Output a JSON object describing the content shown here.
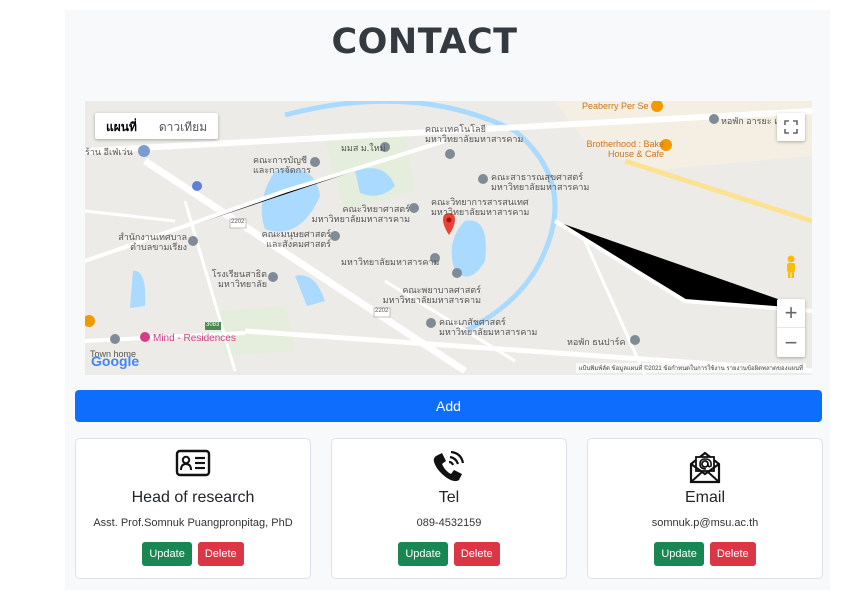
{
  "page": {
    "title": "CONTACT"
  },
  "map": {
    "type_buttons": [
      "แผนที่",
      "ดาวเทียม"
    ],
    "fullscreen_icon": "fullscreen-icon",
    "zoom_in": "+",
    "zoom_out": "−",
    "logo": "Google",
    "footer": "แป้นพิมพ์ลัด   ข้อมูลแผนที่ ©2021   ข้อกำหนดในการใช้งาน   รายงานข้อผิดพลาดของแผนที่",
    "labels": {
      "peaberry": "Peaberry Per Se",
      "brotherhood": "Brotherhood : Bake House & Cafe",
      "dorm_top": "หอพัก อารยะ แ",
      "cafe_left": "ร้าน อีเฟ่เว่น",
      "tech": "คณะเทคโนโลยี มหาวิทยาลัยมหาสารคาม",
      "accounting": "คณะการบัญชี และการจัดการ",
      "msu_new": "มมส ม.ใหม่",
      "public_health": "คณะสาธารณสุขศาสตร์ มหาวิทยาลัยมหาสารคาม",
      "science": "คณะวิทยาศาสตร์ มหาวิทยาลัยมหาสารคาม",
      "it": "คณะวิทยาการสารสนเทศ มหาวิทยาลัยมหาสารคาม",
      "municipal": "สำนักงานเทศบาล ตำบลขามเรียง",
      "humanities": "คณะมนุษยศาสตร์ และสังคมศาสตร์",
      "msu": "มหาวิทยาลัยมหาสารคาม",
      "school": "โรงเรียนสาธิต มหาวิทยาลัย",
      "nursing": "คณะพยาบาลศาสตร์ มหาวิทยาลัยมหาสารคาม",
      "pharmacy": "คณะเภสัชศาสตร์ มหาวิทยาลัยมหาสารคาม",
      "dorm_bottom": "หอพัก ธนปาร์ค",
      "mind": "Mind - Residences",
      "town_home": "Town home",
      "road1": "2202",
      "road2": "2202",
      "road3": "2202",
      "road4": "3083"
    }
  },
  "actions": {
    "add_label": "Add"
  },
  "cards": [
    {
      "icon": "id-card-icon",
      "title": "Head of research",
      "value": "Asst. Prof.Somnuk Puangpronpitag, PhD",
      "update": "Update",
      "delete": "Delete"
    },
    {
      "icon": "phone-ringing-icon",
      "title": "Tel",
      "value": "089-4532159",
      "update": "Update",
      "delete": "Delete"
    },
    {
      "icon": "email-at-icon",
      "title": "Email",
      "value": "somnuk.p@msu.ac.th",
      "update": "Update",
      "delete": "Delete"
    }
  ],
  "colors": {
    "primary": "#0d6efd",
    "success": "#198754",
    "danger": "#dc3545",
    "map_water": "#aadaff",
    "map_road": "#ffffff"
  }
}
